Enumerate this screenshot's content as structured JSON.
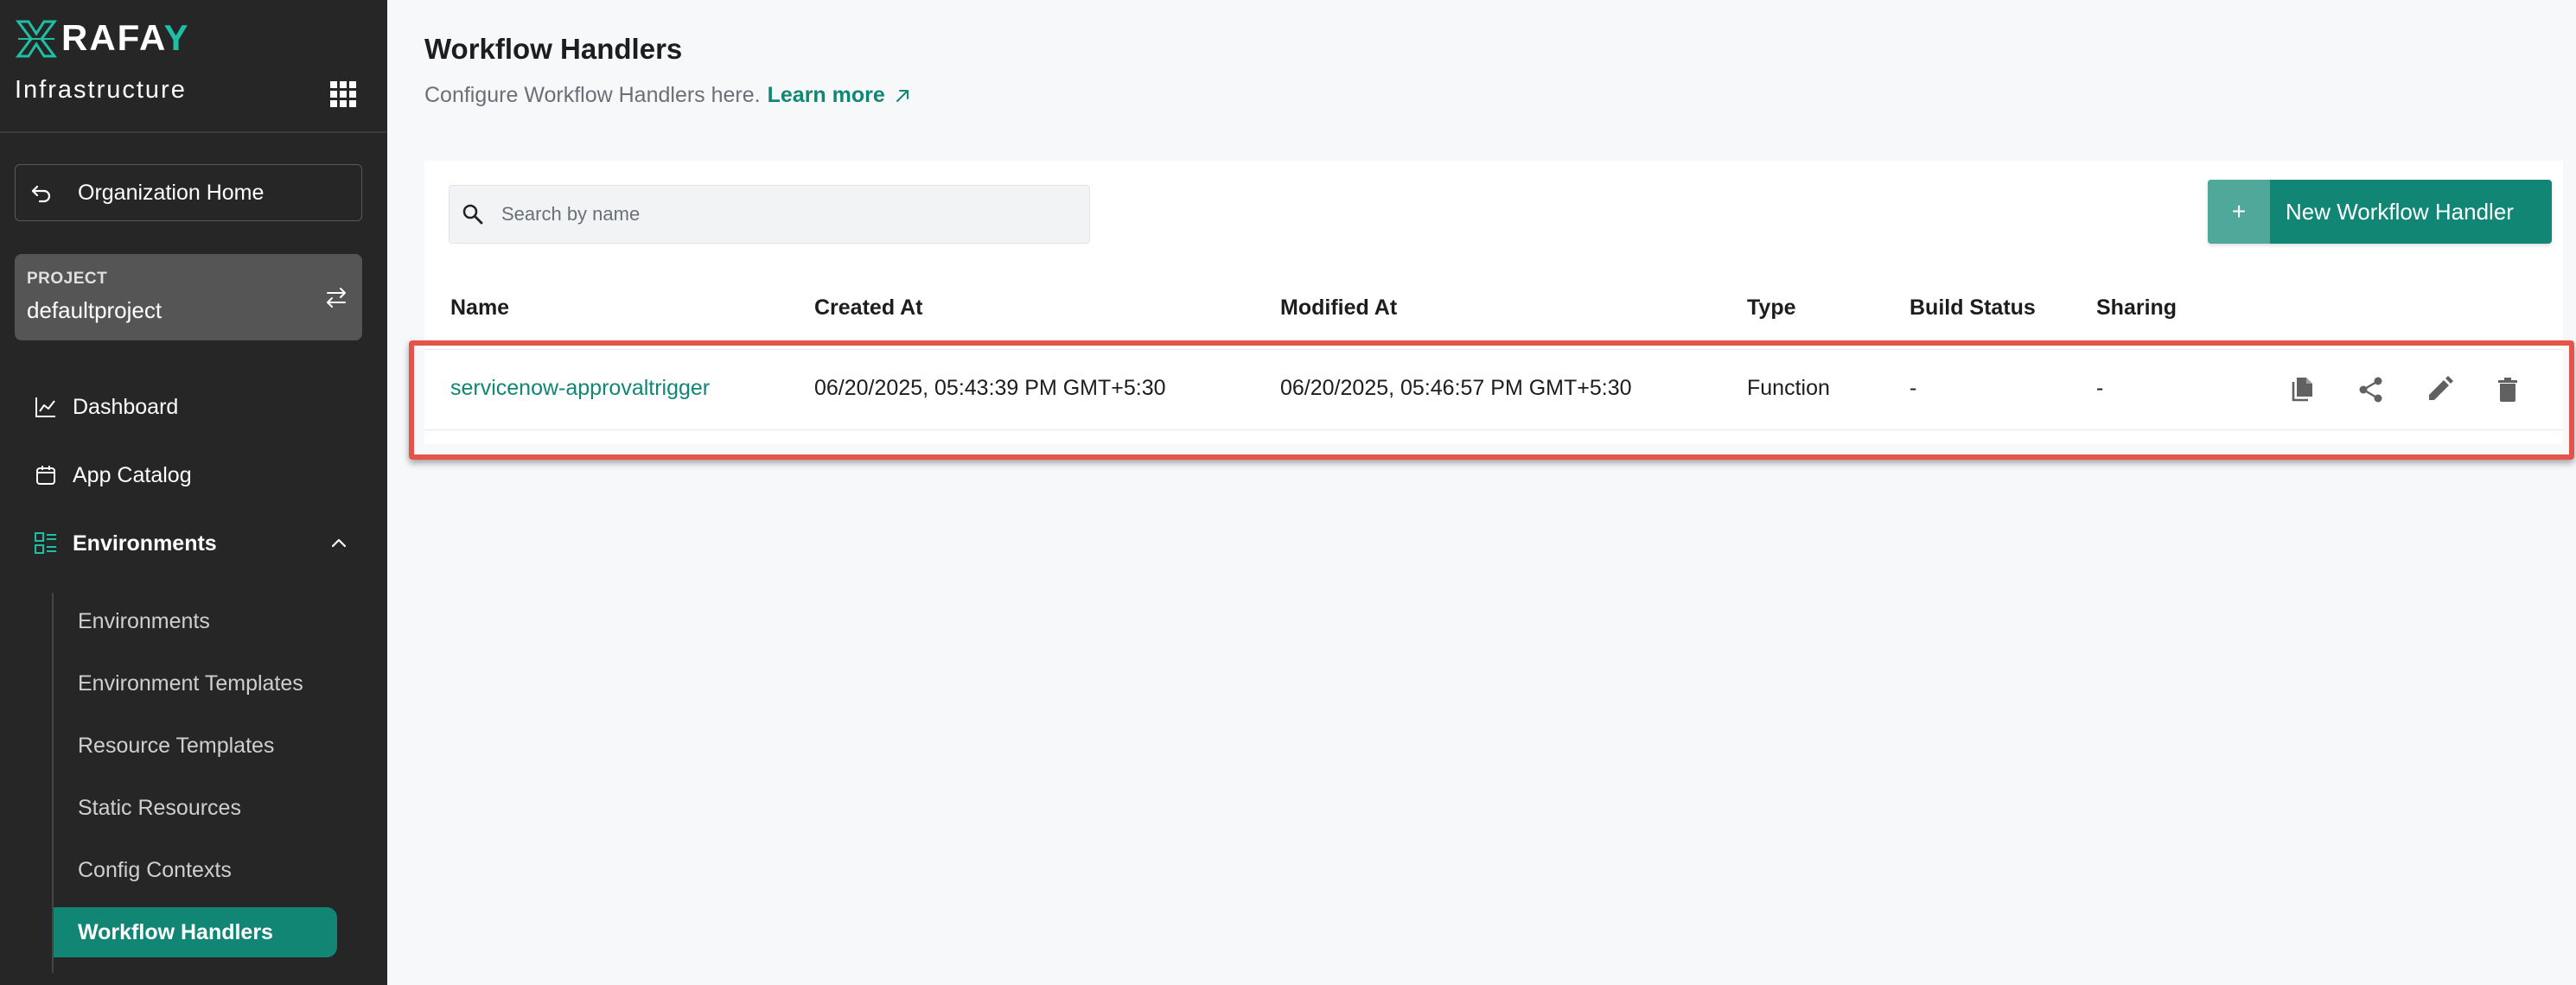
{
  "brand": {
    "name": "RAFA",
    "name_suffix": "Y",
    "accent": "#1fbfa6"
  },
  "sidebar": {
    "product": "Infrastructure",
    "org_home": "Organization Home",
    "project": {
      "caption": "PROJECT",
      "value": "defaultproject"
    },
    "nav": [
      {
        "label": "Dashboard",
        "icon": "chart-line-icon"
      },
      {
        "label": "App Catalog",
        "icon": "catalog-icon"
      },
      {
        "label": "Environments",
        "icon": "environments-icon",
        "expanded": true
      }
    ],
    "sub_items": [
      "Environments",
      "Environment Templates",
      "Resource Templates",
      "Static Resources",
      "Config Contexts",
      "Workflow Handlers"
    ],
    "active_sub": "Workflow Handlers",
    "active_color": "#118674"
  },
  "page": {
    "title": "Workflow Handlers",
    "subtitle": "Configure Workflow Handlers here.",
    "learn_more": "Learn more"
  },
  "search": {
    "placeholder": "Search by name"
  },
  "new_button": {
    "plus": "+",
    "label": "New Workflow Handler"
  },
  "table": {
    "headers": [
      "Name",
      "Created At",
      "Modified At",
      "Type",
      "Build Status",
      "Sharing"
    ],
    "rows": [
      {
        "name": "servicenow-approvaltrigger",
        "created_at": "06/20/2025, 05:43:39 PM GMT+5:30",
        "modified_at": "06/20/2025, 05:46:57 PM GMT+5:30",
        "type": "Function",
        "build_status": "-",
        "sharing": "-",
        "actions": [
          "copy-icon",
          "share-icon",
          "edit-icon",
          "delete-icon"
        ]
      }
    ]
  },
  "highlight_color": "#e5534b"
}
